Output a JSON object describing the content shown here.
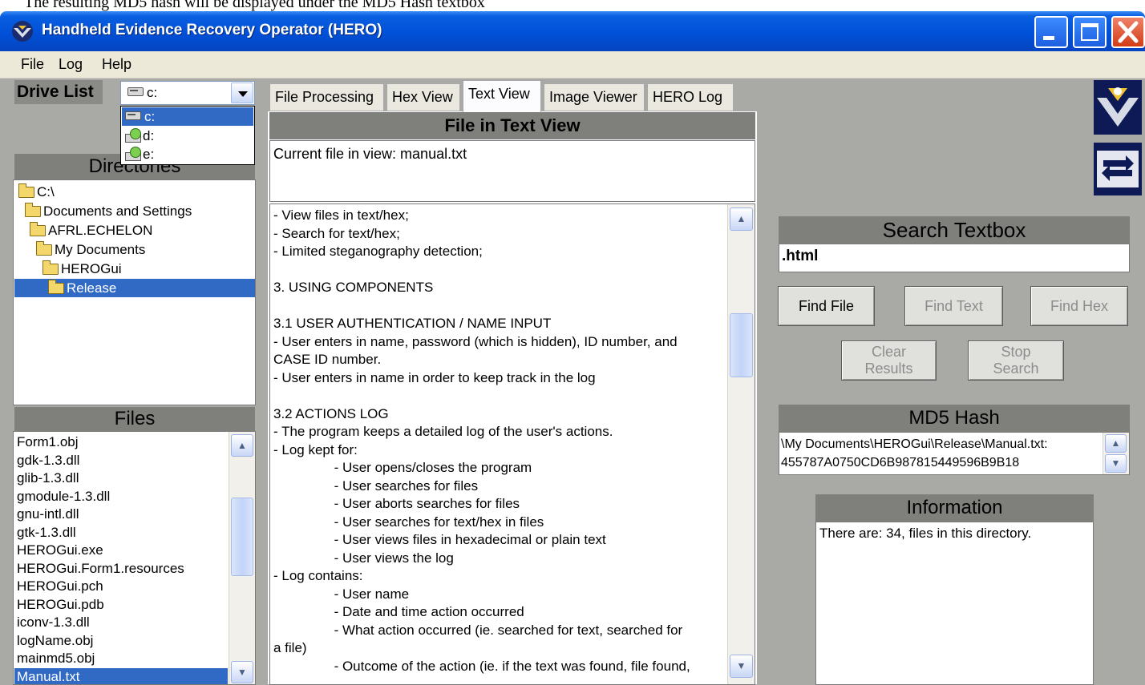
{
  "top_caption": "The resulting MD5 hash will be displayed under the MD5 Hash textbox",
  "window": {
    "title": "Handheld Evidence Recovery Operator (HERO)"
  },
  "menu": [
    "File",
    "Log",
    "Help"
  ],
  "drive_list": {
    "label": "Drive List",
    "selected": "c:",
    "options": [
      "c:",
      "d:",
      "e:"
    ]
  },
  "directories": {
    "header": "Directories",
    "items": [
      "C:\\",
      "Documents and Settings",
      "AFRL.ECHELON",
      "My Documents",
      "HEROGui",
      "Release"
    ],
    "selected": "Release"
  },
  "files": {
    "header": "Files",
    "items": [
      "Form1.obj",
      "gdk-1.3.dll",
      "glib-1.3.dll",
      "gmodule-1.3.dll",
      "gnu-intl.dll",
      "gtk-1.3.dll",
      "HEROGui.exe",
      "HEROGui.Form1.resources",
      "HEROGui.pch",
      "HEROGui.pdb",
      "iconv-1.3.dll",
      "logName.obj",
      "mainmd5.obj",
      "Manual.txt"
    ],
    "selected": "Manual.txt"
  },
  "tabs": [
    "File Processing",
    "Hex View",
    "Text View",
    "Image Viewer",
    "HERO Log"
  ],
  "active_tab": "Text View",
  "text_view": {
    "header": "File in Text View",
    "current_file": "Current file in view: manual.txt",
    "lines": [
      "- View files in text/hex;",
      "- Search for text/hex;",
      "- Limited steganography detection;",
      "",
      "3. USING COMPONENTS",
      "",
      "3.1 USER AUTHENTICATION / NAME INPUT",
      "- User enters in name, password (which is hidden), ID number, and",
      "CASE ID number.",
      "- User enters in name in order to keep track in the log",
      "",
      "3.2 ACTIONS LOG",
      "- The program keeps a detailed log of the user's actions.",
      "- Log kept for:",
      "                - User opens/closes the program",
      "                - User searches for files",
      "                - User aborts searches for files",
      "                - User searches for text/hex in files",
      "                - User views files in hexadecimal or plain text",
      "                - User views the log",
      "- Log contains:",
      "                - User name",
      "                - Date and time action occurred",
      "                - What action occurred (ie. searched for text, searched for",
      "a file)",
      "                - Outcome of the action (ie. if the text was found, file found,"
    ]
  },
  "search": {
    "header": "Search Textbox",
    "value": ".html",
    "buttons": {
      "find_file": "Find File",
      "find_text": "Find Text",
      "find_hex": "Find Hex",
      "clear_results_line1": "Clear",
      "clear_results_line2": "Results",
      "stop_search_line1": "Stop",
      "stop_search_line2": "Search"
    }
  },
  "md5": {
    "header": "MD5 Hash",
    "path": "\\My Documents\\HEROGui\\Release\\Manual.txt:",
    "hash": "455787A0750CD6B987815449596B9B18"
  },
  "information": {
    "header": "Information",
    "text": "There are: 34, files in this directory."
  },
  "colors": {
    "titlebar": "#0050d8",
    "selection": "#316ac5",
    "client": "#a9a9a6"
  }
}
